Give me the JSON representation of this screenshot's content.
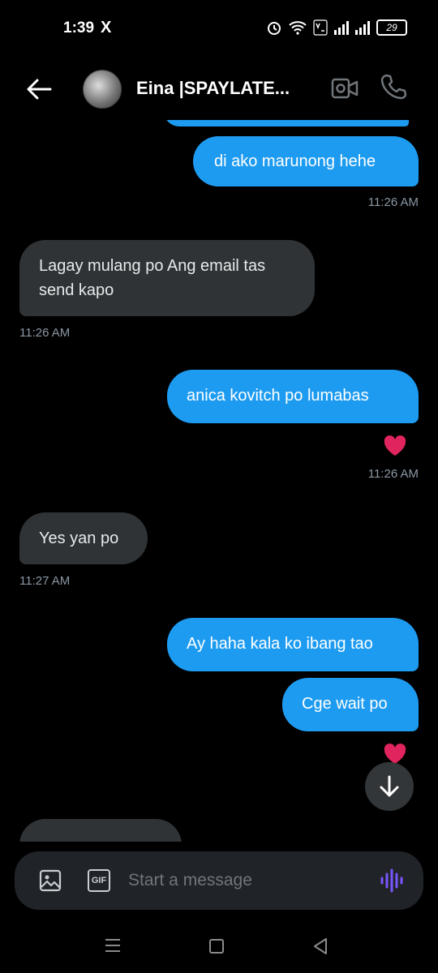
{
  "status_bar": {
    "time": "1:39",
    "x_icon": "X",
    "battery": "29"
  },
  "header": {
    "contact_name": "Eina |SPAYLATE..."
  },
  "messages": [
    {
      "direction": "out",
      "text": "di ako marunong hehe"
    },
    {
      "timestamp": "11:26 AM"
    },
    {
      "direction": "in",
      "text": "Lagay mulang po Ang email tas send kapo"
    },
    {
      "timestamp": "11:26 AM"
    },
    {
      "direction": "out",
      "text": "anica kovitch po lumabas",
      "reaction": "heart"
    },
    {
      "timestamp": "11:26 AM"
    },
    {
      "direction": "in",
      "text": "Yes yan po"
    },
    {
      "timestamp": "11:27 AM"
    },
    {
      "direction": "out",
      "text": "Ay haha kala ko ibang tao"
    },
    {
      "direction": "out",
      "text": "Cge wait po",
      "reaction": "heart"
    }
  ],
  "composer": {
    "placeholder": "Start a message",
    "gif_label": "GIF"
  },
  "colors": {
    "outgoing": "#1d9bf0",
    "incoming": "#2f3336",
    "voice": "#7856ff",
    "heart": "#e0245e"
  }
}
